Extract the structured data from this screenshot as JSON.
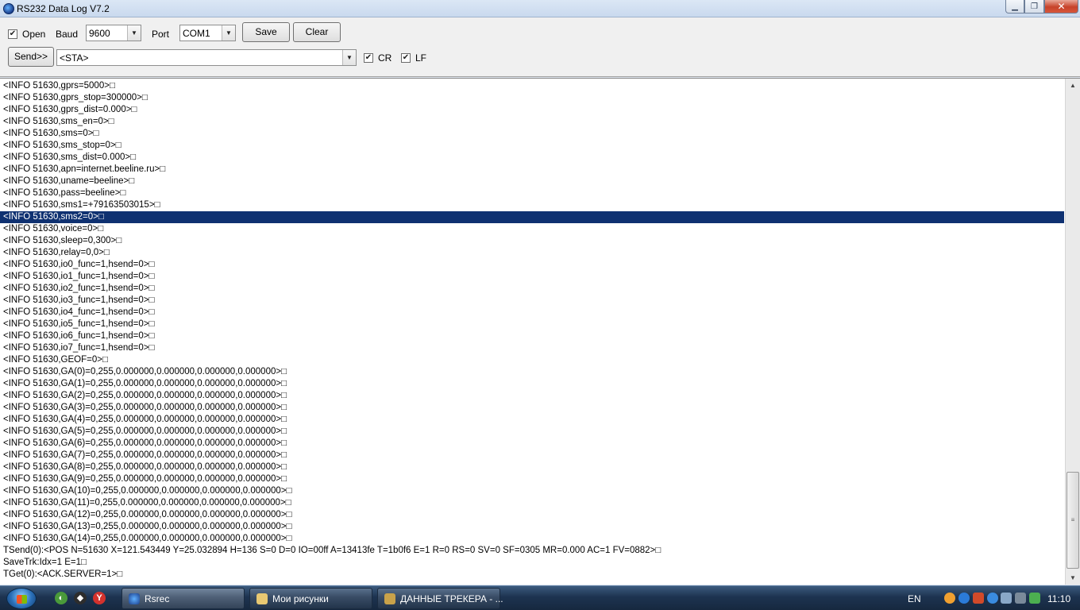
{
  "window": {
    "title": "RS232 Data Log V7.2"
  },
  "toolbar": {
    "open_label": "Open",
    "open_checked": true,
    "baud_label": "Baud",
    "baud_value": "9600",
    "port_label": "Port",
    "port_value": "COM1",
    "save_label": "Save",
    "clear_label": "Clear",
    "send_label": "Send>>",
    "send_value": "<STA>",
    "cr_label": "CR",
    "cr_checked": true,
    "lf_label": "LF",
    "lf_checked": true
  },
  "log": {
    "selected_index": 11,
    "lines": [
      "<INFO 51630,gprs=5000>□",
      "<INFO 51630,gprs_stop=300000>□",
      "<INFO 51630,gprs_dist=0.000>□",
      "<INFO 51630,sms_en=0>□",
      "<INFO 51630,sms=0>□",
      "<INFO 51630,sms_stop=0>□",
      "<INFO 51630,sms_dist=0.000>□",
      "<INFO 51630,apn=internet.beeline.ru>□",
      "<INFO 51630,uname=beeline>□",
      "<INFO 51630,pass=beeline>□",
      "<INFO 51630,sms1=+79163503015>□",
      "<INFO 51630,sms2=0>□",
      "<INFO 51630,voice=0>□",
      "<INFO 51630,sleep=0,300>□",
      "<INFO 51630,relay=0,0>□",
      "<INFO 51630,io0_func=1,hsend=0>□",
      "<INFO 51630,io1_func=1,hsend=0>□",
      "<INFO 51630,io2_func=1,hsend=0>□",
      "<INFO 51630,io3_func=1,hsend=0>□",
      "<INFO 51630,io4_func=1,hsend=0>□",
      "<INFO 51630,io5_func=1,hsend=0>□",
      "<INFO 51630,io6_func=1,hsend=0>□",
      "<INFO 51630,io7_func=1,hsend=0>□",
      "<INFO 51630,GEOF=0>□",
      "<INFO 51630,GA(0)=0,255,0.000000,0.000000,0.000000,0.000000>□",
      "<INFO 51630,GA(1)=0,255,0.000000,0.000000,0.000000,0.000000>□",
      "<INFO 51630,GA(2)=0,255,0.000000,0.000000,0.000000,0.000000>□",
      "<INFO 51630,GA(3)=0,255,0.000000,0.000000,0.000000,0.000000>□",
      "<INFO 51630,GA(4)=0,255,0.000000,0.000000,0.000000,0.000000>□",
      "<INFO 51630,GA(5)=0,255,0.000000,0.000000,0.000000,0.000000>□",
      "<INFO 51630,GA(6)=0,255,0.000000,0.000000,0.000000,0.000000>□",
      "<INFO 51630,GA(7)=0,255,0.000000,0.000000,0.000000,0.000000>□",
      "<INFO 51630,GA(8)=0,255,0.000000,0.000000,0.000000,0.000000>□",
      "<INFO 51630,GA(9)=0,255,0.000000,0.000000,0.000000,0.000000>□",
      "<INFO 51630,GA(10)=0,255,0.000000,0.000000,0.000000,0.000000>□",
      "<INFO 51630,GA(11)=0,255,0.000000,0.000000,0.000000,0.000000>□",
      "<INFO 51630,GA(12)=0,255,0.000000,0.000000,0.000000,0.000000>□",
      "<INFO 51630,GA(13)=0,255,0.000000,0.000000,0.000000,0.000000>□",
      "<INFO 51630,GA(14)=0,255,0.000000,0.000000,0.000000,0.000000>□",
      "TSend(0):<POS N=51630 X=121.543449 Y=25.032894 H=136 S=0 D=0 IO=00ff A=13413fe T=1b0f6 E=1 R=0 RS=0 SV=0 SF=0305 MR=0.000 AC=1 FV=0882>□",
      "SaveTrk:Idx=1 E=1□",
      "TGet(0):<ACK.SERVER=1>□"
    ]
  },
  "taskbar": {
    "tasks": [
      {
        "label": "Rsrec",
        "active": true
      },
      {
        "label": "Мои рисунки",
        "active": false
      },
      {
        "label": "ДАННЫЕ ТРЕКЕРА - ...",
        "active": false
      }
    ],
    "language": "EN",
    "clock": "11:10"
  }
}
